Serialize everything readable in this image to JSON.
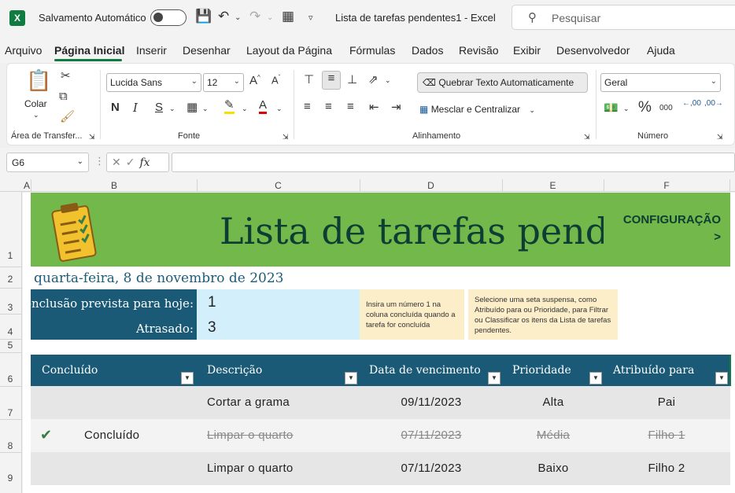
{
  "titlebar": {
    "autosave_label": "Salvamento Automático",
    "doc_title": "Lista de tarefas pendentes1  -  Excel",
    "search_placeholder": "Pesquisar"
  },
  "menu": {
    "items": [
      "Arquivo",
      "Página Inicial",
      "Inserir",
      "Desenhar",
      "Layout da Página",
      "Fórmulas",
      "Dados",
      "Revisão",
      "Exibir",
      "Desenvolvedor",
      "Ajuda"
    ],
    "active": "Página Inicial"
  },
  "ribbon": {
    "paste_label": "Colar",
    "clipboard_group": "Área de Transfer...",
    "font_name": "Lucida Sans",
    "font_size": "12",
    "font_group": "Fonte",
    "bold": "N",
    "italic": "I",
    "underline": "S",
    "wrap_text": "Quebrar Texto Automaticamente",
    "merge_center": "Mesclar e Centralizar",
    "alignment_group": "Alinhamento",
    "number_format": "Geral",
    "number_group": "Número",
    "percent": "%",
    "thousands": "000",
    "dec_increase": ",00",
    "dec_decrease": ",00"
  },
  "formula_bar": {
    "name_box": "G6",
    "fx": "fx",
    "formula": ""
  },
  "columns": [
    "A",
    "B",
    "C",
    "D",
    "E",
    "F"
  ],
  "rows": [
    "1",
    "2",
    "3",
    "4",
    "5",
    "6",
    "7",
    "8",
    "9"
  ],
  "sheet": {
    "title": "Lista de tarefas pendentes",
    "config_line1": "CONFIGURAÇÃO",
    "config_line2": ">",
    "date": "quarta-feira, 8 de novembro de 2023",
    "summary": {
      "due_today_label": "Conclusão prevista para hoje:",
      "due_today_value": "1",
      "overdue_label": "Atrasado:",
      "overdue_value": "3"
    },
    "note1": "Insira um número 1 na coluna concluída quando a tarefa for concluída",
    "note2": "Selecione uma seta suspensa, como Atribuído para ou Prioridade, para Filtrar ou Classificar os itens da Lista de tarefas pendentes.",
    "table": {
      "headers": [
        "Concluído",
        "Descrição",
        "Data de vencimento",
        "Prioridade",
        "Atribuído para"
      ],
      "rows": [
        {
          "done": "",
          "description": "Cortar a grama",
          "due": "09/11/2023",
          "priority": "Alta",
          "assigned": "Pai"
        },
        {
          "done": "Concluído",
          "description": "Limpar o quarto",
          "due": "07/11/2023",
          "priority": "Média",
          "assigned": "Filho 1"
        },
        {
          "done": "",
          "description": "Limpar o quarto",
          "due": "07/11/2023",
          "priority": "Baixo",
          "assigned": "Filho 2"
        }
      ]
    }
  },
  "colors": {
    "excel_green": "#107c41",
    "banner_green": "#72b84a",
    "header_blue": "#1a5a76",
    "value_blue": "#d4effc",
    "note_yellow": "#fdeeca"
  }
}
